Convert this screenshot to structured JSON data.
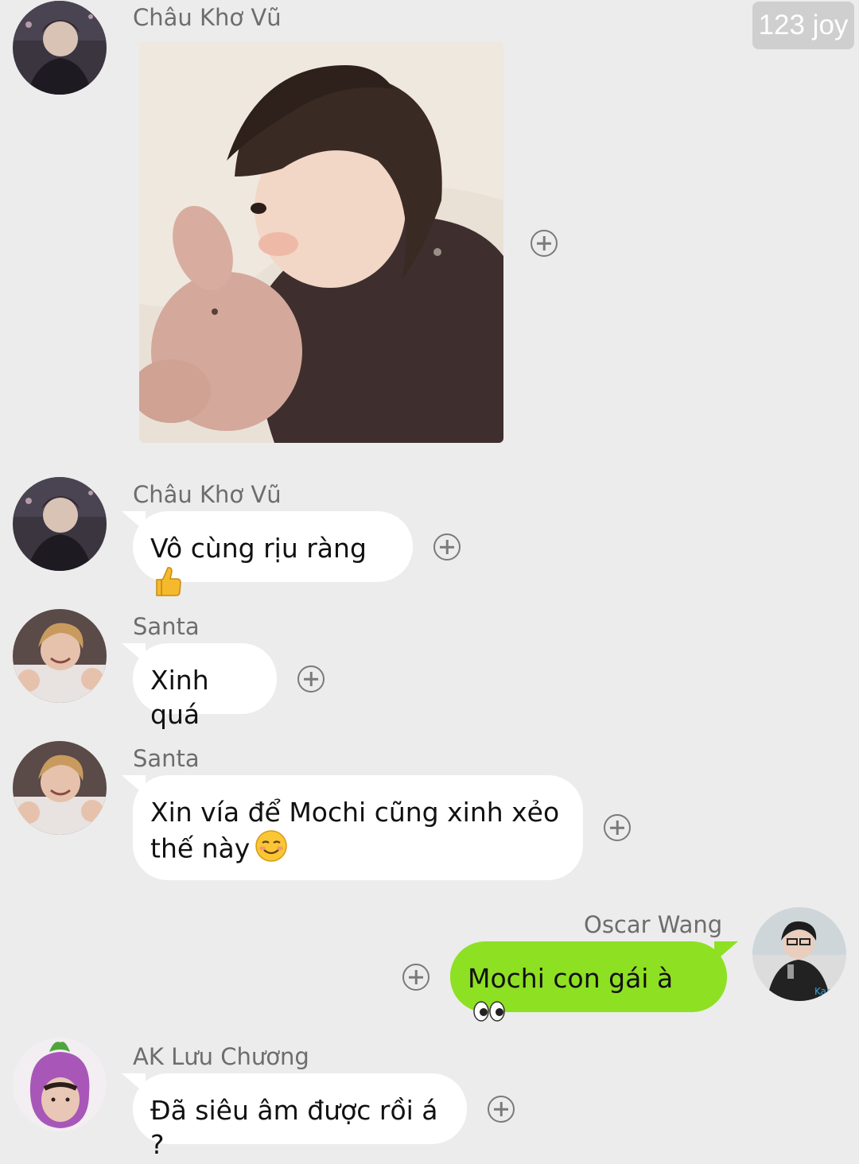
{
  "badge": "123 joy",
  "messages": [
    {
      "sender": "Châu Khơ Vũ",
      "kind": "image",
      "image_desc": "photo"
    },
    {
      "sender": "Châu Khơ Vũ",
      "kind": "text",
      "text": "Vô cùng rịu ràng",
      "emoji": "thumbs-up"
    },
    {
      "sender": "Santa",
      "kind": "text",
      "text": "Xinh quá"
    },
    {
      "sender": "Santa",
      "kind": "text",
      "text_line1": "Xin vía để Mochi cũng xinh xẻo",
      "text_line2": "thế này",
      "emoji": "smiling-face"
    },
    {
      "sender": "Oscar Wang",
      "kind": "text",
      "text": "Mochi con gái à",
      "emoji": "eyes",
      "outgoing": true
    },
    {
      "sender": "AK Lưu Chương",
      "kind": "text",
      "text": "Đã siêu âm được rồi á ?"
    }
  ],
  "colors": {
    "background": "#ececec",
    "incoming_bubble": "#ffffff",
    "outgoing_bubble": "#8ee023",
    "badge": "#cfcfcf"
  }
}
